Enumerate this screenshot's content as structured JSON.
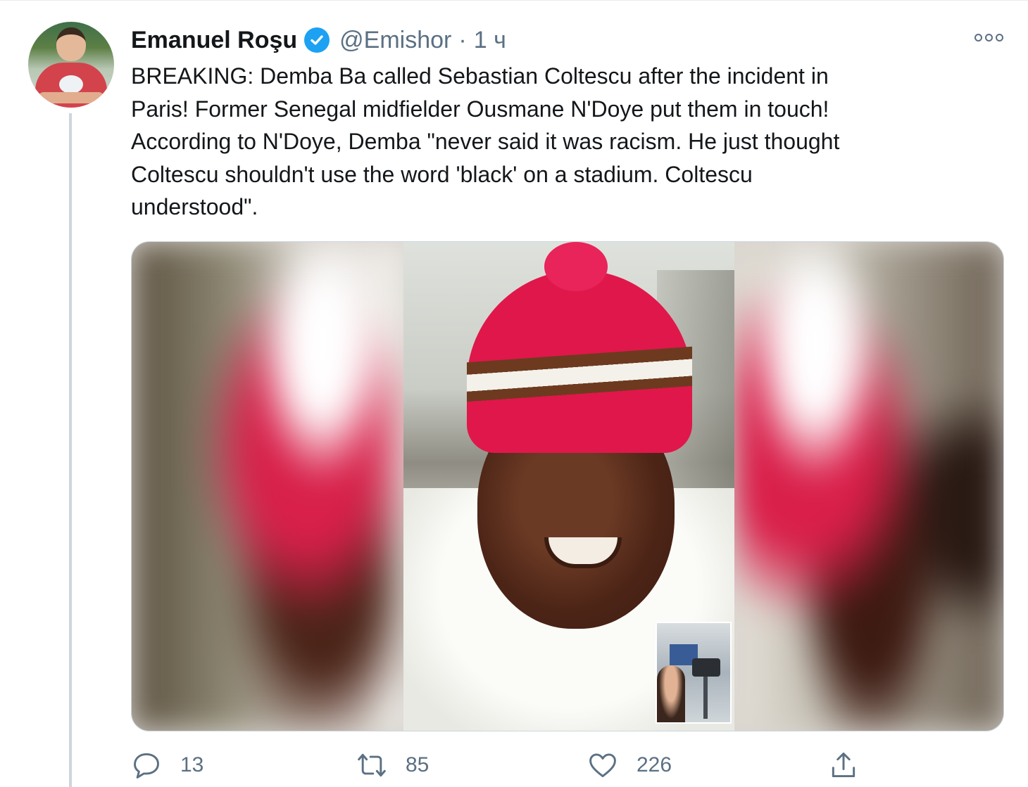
{
  "tweet": {
    "author_name": "Emanuel Roşu",
    "handle": "@Emishor",
    "separator": "·",
    "time": "1 ч",
    "text": "BREAKING: Demba Ba called Sebastian Coltescu after the incident in\nParis! Former Senegal midfielder Ousmane N'Doye put them in touch!\nAccording to N'Doye, Demba \"never said it was racism. He just thought\nColtescu shouldn't use the word 'black' on a stadium. Coltescu\nunderstood\"."
  },
  "actions": {
    "replies": "13",
    "retweets": "85",
    "likes": "226"
  },
  "icons": {
    "verified": "verified-badge-icon",
    "more": "more-options-icon",
    "reply": "reply-icon",
    "retweet": "retweet-icon",
    "like": "heart-icon",
    "share": "share-icon"
  },
  "colors": {
    "verified": "#1da1f2",
    "secondary_text": "#5b7083",
    "thread_line": "#ccd6dd"
  }
}
